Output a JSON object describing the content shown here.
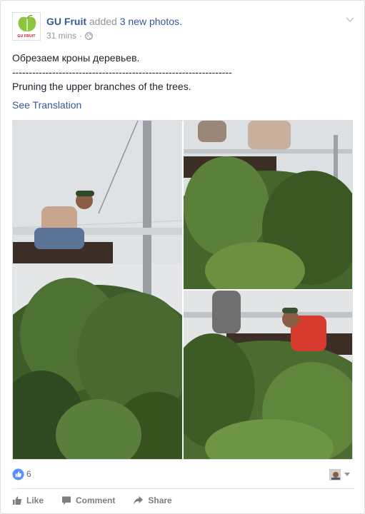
{
  "post": {
    "page_name": "GU Fruit",
    "action": "added",
    "photos_link": "3 new photos.",
    "timestamp": "31 mins",
    "separator": "·",
    "avatar_label": "GU FRUIT",
    "text_lines": [
      "Обрезаем кроны деревьев.",
      "------------------------------------------------------------------",
      "Pruning the upper branches of the trees."
    ],
    "see_translation": "See Translation"
  },
  "photos": [
    {
      "name": "photo-worker-on-ladder"
    },
    {
      "name": "photo-workers-on-platform"
    },
    {
      "name": "photo-worker-red-shirt"
    }
  ],
  "reactions": {
    "like_count": "6"
  },
  "actions": {
    "like": "Like",
    "comment": "Comment",
    "share": "Share"
  },
  "colors": {
    "link": "#365899",
    "muted": "#90949c",
    "like_blue": "#5890ff"
  }
}
